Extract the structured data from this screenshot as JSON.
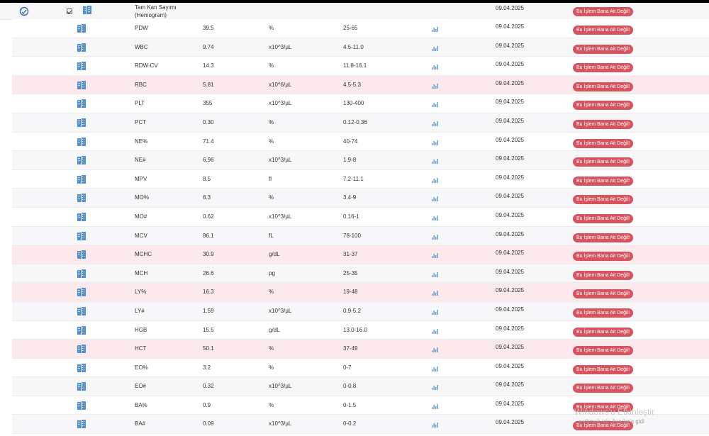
{
  "colors": {
    "button_bg": "#d5545f",
    "flag_row_bg": "#fbe9ec",
    "icon_blue": "#4f8fd6"
  },
  "header": {
    "group_title": "Tam Kan Sayımı\n(Hemogram)",
    "date": "09.04.2025",
    "button_label": "Bu İşlem Bana Ait Değil!",
    "icons": [
      "refresh-icon",
      "checkbox",
      "building-icon"
    ]
  },
  "rows": [
    {
      "name": "PDW",
      "value": "39.5",
      "unit": "%",
      "range": "25-65",
      "date": "09.04.2025",
      "button": "Bu İşlem Bana Ait Değil!",
      "flag": false
    },
    {
      "name": "WBC",
      "value": "9.74",
      "unit": "x10^3/µL",
      "range": "4.5-11.0",
      "date": "09.04.2025",
      "button": "Bu İşlem Bana Ait Değil!",
      "flag": false
    },
    {
      "name": "RDW-CV",
      "value": "14.3",
      "unit": "%",
      "range": "11.8-16.1",
      "date": "09.04.2025",
      "button": "Bu İşlem Bana Ait Değil!",
      "flag": false
    },
    {
      "name": "RBC",
      "value": "5.81",
      "unit": "x10^6/µL",
      "range": "4.5-5.3",
      "date": "09.04.2025",
      "button": "Bu İşlem Bana Ait Değil!",
      "flag": true
    },
    {
      "name": "PLT",
      "value": "355",
      "unit": "x10^3/µL",
      "range": "130-400",
      "date": "09.04.2025",
      "button": "Bu İşlem Bana Ait Değil!",
      "flag": false
    },
    {
      "name": "PCT",
      "value": "0.30",
      "unit": "%",
      "range": "0.12-0.36",
      "date": "09.04.2025",
      "button": "Bu İşlem Bana Ait Değil!",
      "flag": false
    },
    {
      "name": "NE%",
      "value": "71.4",
      "unit": "%",
      "range": "40-74",
      "date": "09.04.2025",
      "button": "Bu İşlem Bana Ait Değil!",
      "flag": false
    },
    {
      "name": "NE#",
      "value": "6.96",
      "unit": "x10^3/µL",
      "range": "1.9-8",
      "date": "09.04.2025",
      "button": "Bu İşlem Bana Ait Değil!",
      "flag": false
    },
    {
      "name": "MPV",
      "value": "8.5",
      "unit": "fl",
      "range": "7.2-11.1",
      "date": "09.04.2025",
      "button": "Bu İşlem Bana Ait Değil!",
      "flag": false
    },
    {
      "name": "MO%",
      "value": "6.3",
      "unit": "%",
      "range": "3.4-9",
      "date": "09.04.2025",
      "button": "Bu İşlem Bana Ait Değil!",
      "flag": false
    },
    {
      "name": "MO#",
      "value": "0.62",
      "unit": "x10^3/µL",
      "range": "0.16-1",
      "date": "09.04.2025",
      "button": "Bu İşlem Bana Ait Değil!",
      "flag": false
    },
    {
      "name": "MCV",
      "value": "86.1",
      "unit": "fL",
      "range": "78-100",
      "date": "09.04.2025",
      "button": "Bu İşlem Bana Ait Değil!",
      "flag": false
    },
    {
      "name": "MCHC",
      "value": "30.9",
      "unit": "g/dL",
      "range": "31-37",
      "date": "09.04.2025",
      "button": "Bu İşlem Bana Ait Değil!",
      "flag": true
    },
    {
      "name": "MCH",
      "value": "26.6",
      "unit": "pg",
      "range": "25-35",
      "date": "09.04.2025",
      "button": "Bu İşlem Bana Ait Değil!",
      "flag": false
    },
    {
      "name": "LY%",
      "value": "16.3",
      "unit": "%",
      "range": "19-48",
      "date": "09.04.2025",
      "button": "Bu İşlem Bana Ait Değil!",
      "flag": true
    },
    {
      "name": "LY#",
      "value": "1.59",
      "unit": "x10^3/µL",
      "range": "0.9-5.2",
      "date": "09.04.2025",
      "button": "Bu İşlem Bana Ait Değil!",
      "flag": false
    },
    {
      "name": "HGB",
      "value": "15.5",
      "unit": "g/dL",
      "range": "13.0-16.0",
      "date": "09.04.2025",
      "button": "Bu İşlem Bana Ait Değil!",
      "flag": false
    },
    {
      "name": "HCT",
      "value": "50.1",
      "unit": "%",
      "range": "37-49",
      "date": "09.04.2025",
      "button": "Bu İşlem Bana Ait Değil!",
      "flag": true
    },
    {
      "name": "EO%",
      "value": "3.2",
      "unit": "%",
      "range": "0-7",
      "date": "09.04.2025",
      "button": "Bu İşlem Bana Ait Değil!",
      "flag": false
    },
    {
      "name": "EO#",
      "value": "0.32",
      "unit": "x10^3/µL",
      "range": "0-0.8",
      "date": "09.04.2025",
      "button": "Bu İşlem Bana Ait Değil!",
      "flag": false
    },
    {
      "name": "BA%",
      "value": "0.9",
      "unit": "%",
      "range": "0-1.5",
      "date": "09.04.2025",
      "button": "Bu İşlem Bana Ait Değil!",
      "flag": false
    },
    {
      "name": "BA#",
      "value": "0.09",
      "unit": "x10^3/µL",
      "range": "0-0.2",
      "date": "09.04.2025",
      "button": "Bu İşlem Bana Ait Değil!",
      "flag": false
    }
  ],
  "watermark": {
    "line1": "Windows'u Etkinleştir",
    "line2": "...eştirmek için Ayarlar'a gidi"
  }
}
